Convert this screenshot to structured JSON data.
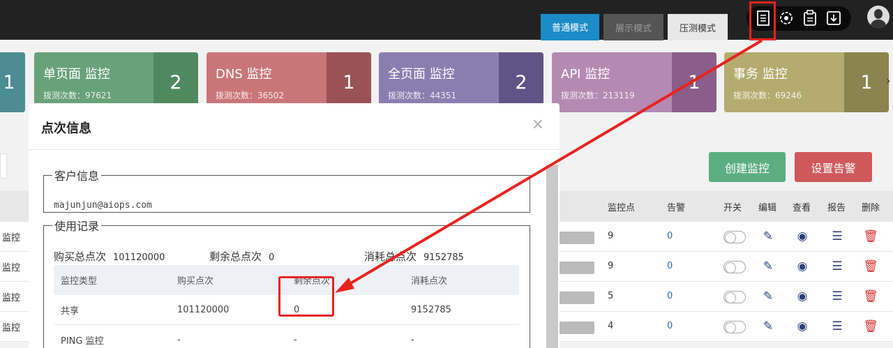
{
  "header": {
    "modes": [
      "普通模式",
      "展示模式",
      "压测模式"
    ]
  },
  "cards": [
    {
      "title": "",
      "sub": "",
      "count": "1"
    },
    {
      "title": "单页面 监控",
      "sub": "拨测次数：97621",
      "count": "2"
    },
    {
      "title": "DNS 监控",
      "sub": "拨测次数：36502",
      "count": "1"
    },
    {
      "title": "全页面 监控",
      "sub": "拨测次数：44351",
      "count": "2"
    },
    {
      "title": "API 监控",
      "sub": "拨测次数：213119",
      "count": "1"
    },
    {
      "title": "事务 监控",
      "sub": "拨测次数：69246",
      "count": "1"
    }
  ],
  "actions": {
    "create": "创建监控",
    "alarm": "设置告警"
  },
  "table": {
    "headers": {
      "points": "监控点",
      "alarm": "告警",
      "switch": "开关",
      "edit": "编辑",
      "view": "查看",
      "report": "报告",
      "delete": "删除"
    },
    "rows": [
      {
        "name": "监控",
        "points": "9",
        "alarm": "0"
      },
      {
        "name": "监控",
        "points": "9",
        "alarm": "0"
      },
      {
        "name": "监控",
        "points": "5",
        "alarm": "0"
      },
      {
        "name": "监控",
        "points": "4",
        "alarm": "0"
      }
    ]
  },
  "modal": {
    "title": "点次信息",
    "close": "×",
    "customer_legend": "客户信息",
    "email": "majunjun@aiops.com",
    "usage_legend": "使用记录",
    "summary": {
      "bought_label": "购买总点次",
      "bought": "101120000",
      "remain_label": "剩余总点次",
      "remain": "0",
      "used_label": "消耗总点次",
      "used": "9152785"
    },
    "columns": [
      "监控类型",
      "购买点次",
      "剩余点次",
      "消耗点次"
    ],
    "rows": [
      [
        "共享",
        "101120000",
        "0",
        "9152785"
      ],
      [
        "PING 监控",
        "-",
        "-",
        "-"
      ]
    ]
  },
  "colors": {
    "annotation": "#e8231e",
    "mode_active": "#1b8cc8"
  }
}
